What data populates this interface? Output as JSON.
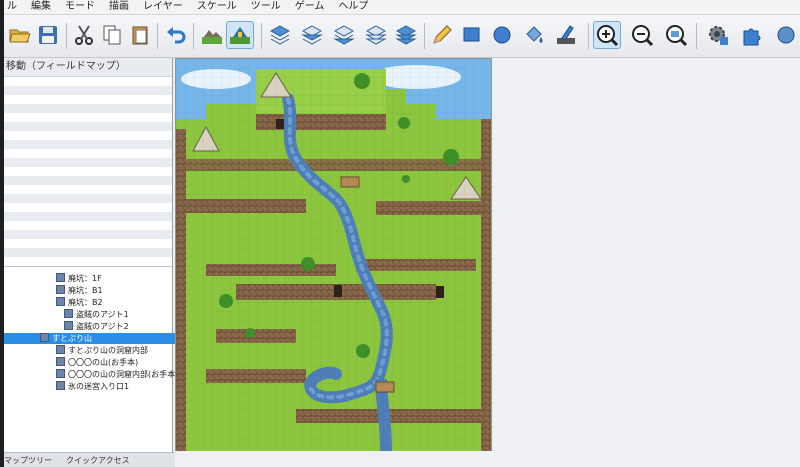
{
  "menu": [
    "ル",
    "編集",
    "モード",
    "描画",
    "レイヤー",
    "スケール",
    "ツール",
    "ゲーム",
    "ヘルプ"
  ],
  "toolbar": {
    "icons": [
      "open-folder-icon",
      "save-icon",
      "cut-icon",
      "copy-icon",
      "paste-icon",
      "undo-icon",
      "map-mode-icon",
      "event-mode-icon",
      "layer1-icon",
      "layer2-icon",
      "layer3-icon",
      "layer4-icon",
      "layer-all-icon",
      "pencil-icon",
      "rectangle-icon",
      "ellipse-icon",
      "fill-icon",
      "shadow-pen-icon",
      "zoom-in-icon",
      "zoom-out-icon",
      "zoom-100-icon",
      "database-icon",
      "plugin-icon"
    ],
    "active": "zoom-in-icon"
  },
  "left_panel": {
    "title": "移動（フィールドマップ）",
    "tree": [
      {
        "label": "廃坑：1F",
        "indent": 1,
        "selected": false
      },
      {
        "label": "廃坑：B1",
        "indent": 1,
        "selected": false
      },
      {
        "label": "廃坑：B2",
        "indent": 1,
        "selected": false
      },
      {
        "label": "盗賊のアジト1",
        "indent": 2,
        "selected": false
      },
      {
        "label": "盗賊のアジト2",
        "indent": 2,
        "selected": false
      },
      {
        "label": "すとぷり山",
        "indent": 0,
        "selected": true
      },
      {
        "label": "すとぷり山の洞窟内部",
        "indent": 1,
        "selected": false
      },
      {
        "label": "〇〇〇の山(お手本)",
        "indent": 1,
        "selected": false
      },
      {
        "label": "〇〇〇の山の洞窟内部(お手本",
        "indent": 1,
        "selected": false
      },
      {
        "label": "氷の迷宮入り口1",
        "indent": 1,
        "selected": false
      }
    ],
    "tabs": [
      "マップツリー",
      "クイックアクセス"
    ]
  },
  "colors": {
    "selection": "#2b8ee6",
    "grass": "#8cc63f",
    "water": "#4f7fb8",
    "cliff": "#8a6a4a",
    "sky": "#6fb2e8"
  }
}
